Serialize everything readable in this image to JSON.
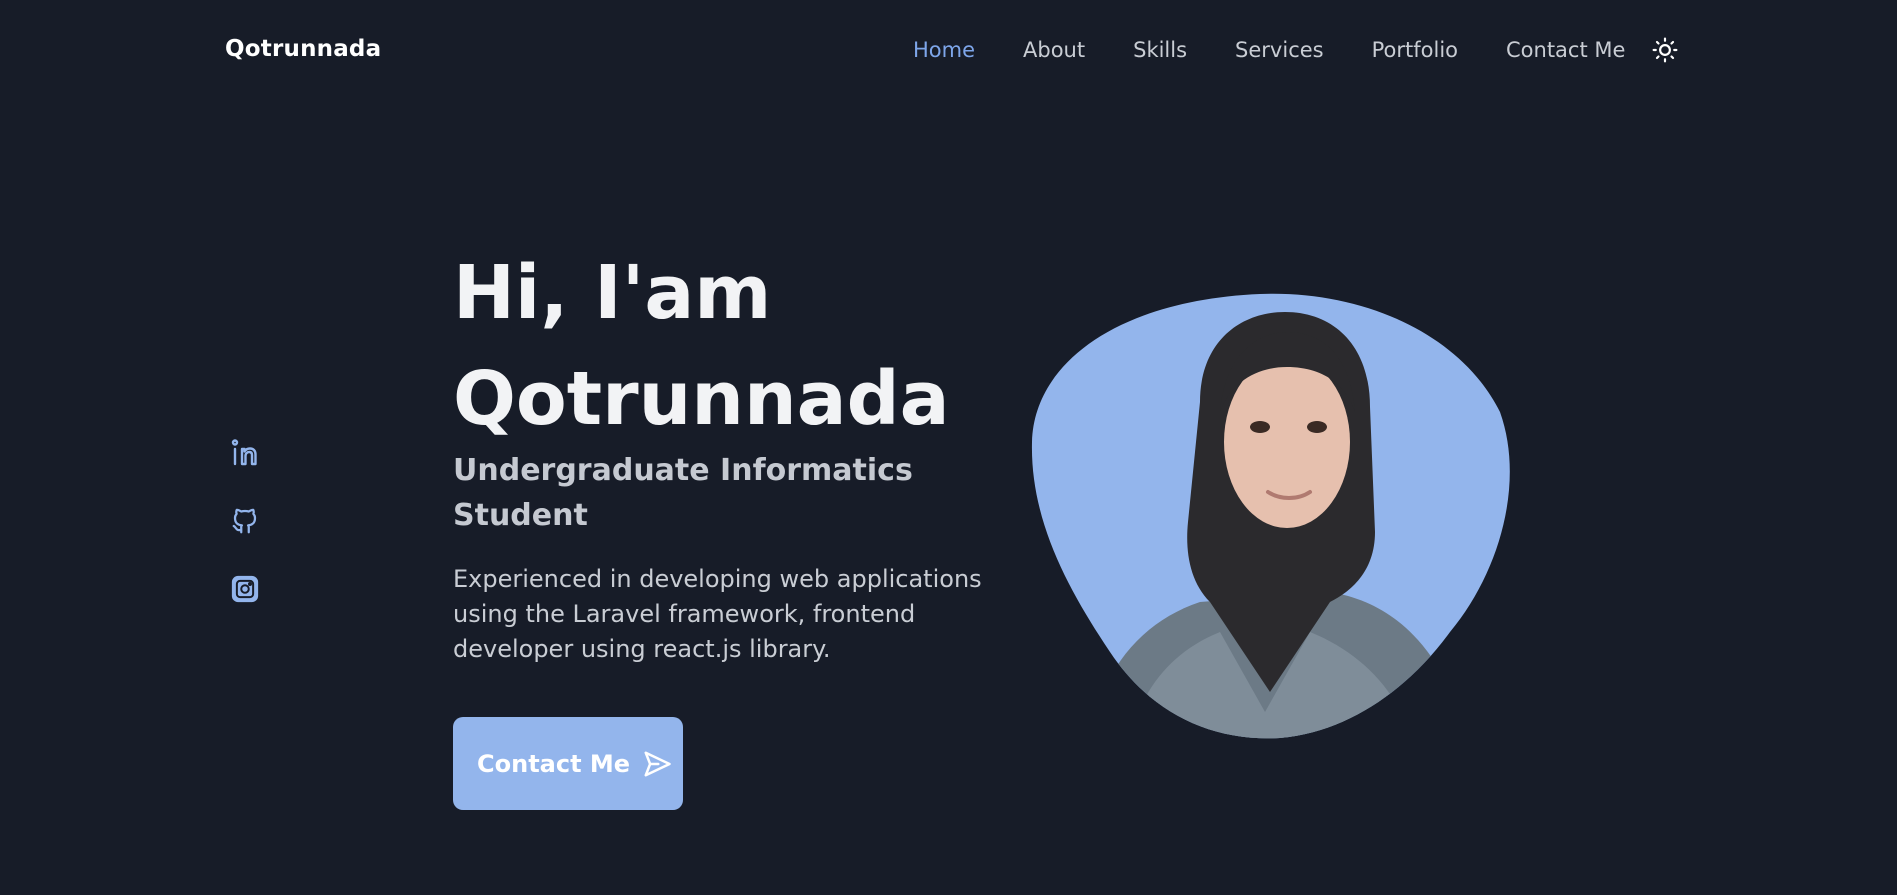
{
  "header": {
    "logo": "Qotrunnada",
    "nav": [
      {
        "label": "Home",
        "active": true
      },
      {
        "label": "About"
      },
      {
        "label": "Skills"
      },
      {
        "label": "Services"
      },
      {
        "label": "Portfolio"
      },
      {
        "label": "Contact Me"
      }
    ],
    "theme_icon": "sun-icon"
  },
  "socials": [
    {
      "icon": "linkedin-icon"
    },
    {
      "icon": "github-icon"
    },
    {
      "icon": "instagram-icon"
    }
  ],
  "hero": {
    "greeting": "Hi, I'am",
    "name": "Qotrunnada",
    "subtitle": "Undergraduate Informatics Student",
    "description": "Experienced in developing web applications using the Laravel framework, frontend developer using react.js library.",
    "cta_label": "Contact Me",
    "cta_icon": "send-icon"
  },
  "colors": {
    "background": "#171c28",
    "accent": "#93b5ec",
    "nav_active": "#7ea6ea",
    "text": "#c9cdd4"
  }
}
